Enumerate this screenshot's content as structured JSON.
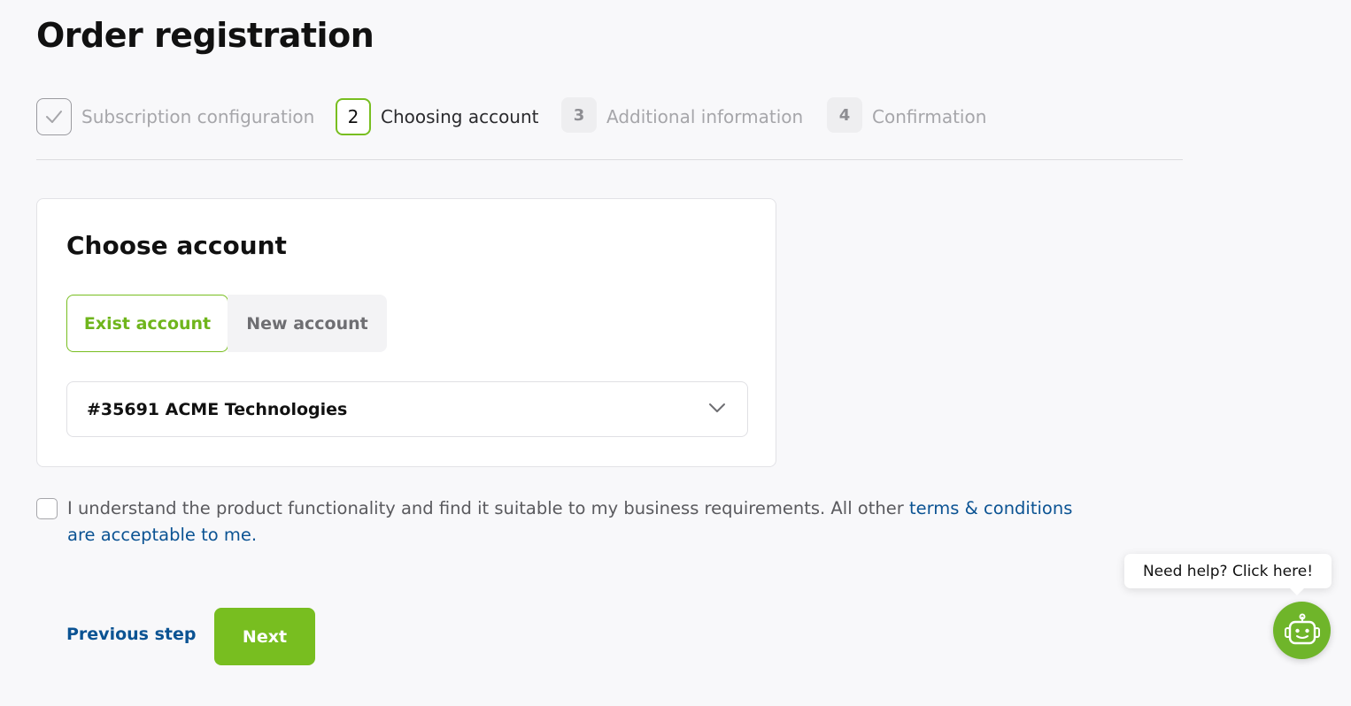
{
  "page": {
    "title": "Order registration"
  },
  "stepper": {
    "steps": [
      {
        "number": "",
        "label": "Subscription configuration",
        "state": "done",
        "icon": "check-icon"
      },
      {
        "number": "2",
        "label": "Choosing account",
        "state": "active"
      },
      {
        "number": "3",
        "label": "Additional information",
        "state": "todo"
      },
      {
        "number": "4",
        "label": "Confirmation",
        "state": "todo"
      }
    ]
  },
  "account_card": {
    "title": "Choose account",
    "tabs": [
      {
        "label": "Exist account",
        "selected": true
      },
      {
        "label": "New account",
        "selected": false
      }
    ],
    "account_select": {
      "value": "#35691 ACME Technologies",
      "icon": "chevron-down-icon"
    }
  },
  "agreement": {
    "checked": false,
    "text": "I understand the product functionality and find it suitable to my business requirements. All other ",
    "link_text": "terms & conditions are acceptable to me."
  },
  "footer": {
    "previous_label": "Previous step",
    "next_label": "Next"
  },
  "help": {
    "bubble_text": "Need help? Click here!",
    "icon": "robot-icon"
  },
  "colors": {
    "accent_green": "#78be20",
    "link_blue": "#0b5393",
    "background": "#f8f8fa"
  }
}
